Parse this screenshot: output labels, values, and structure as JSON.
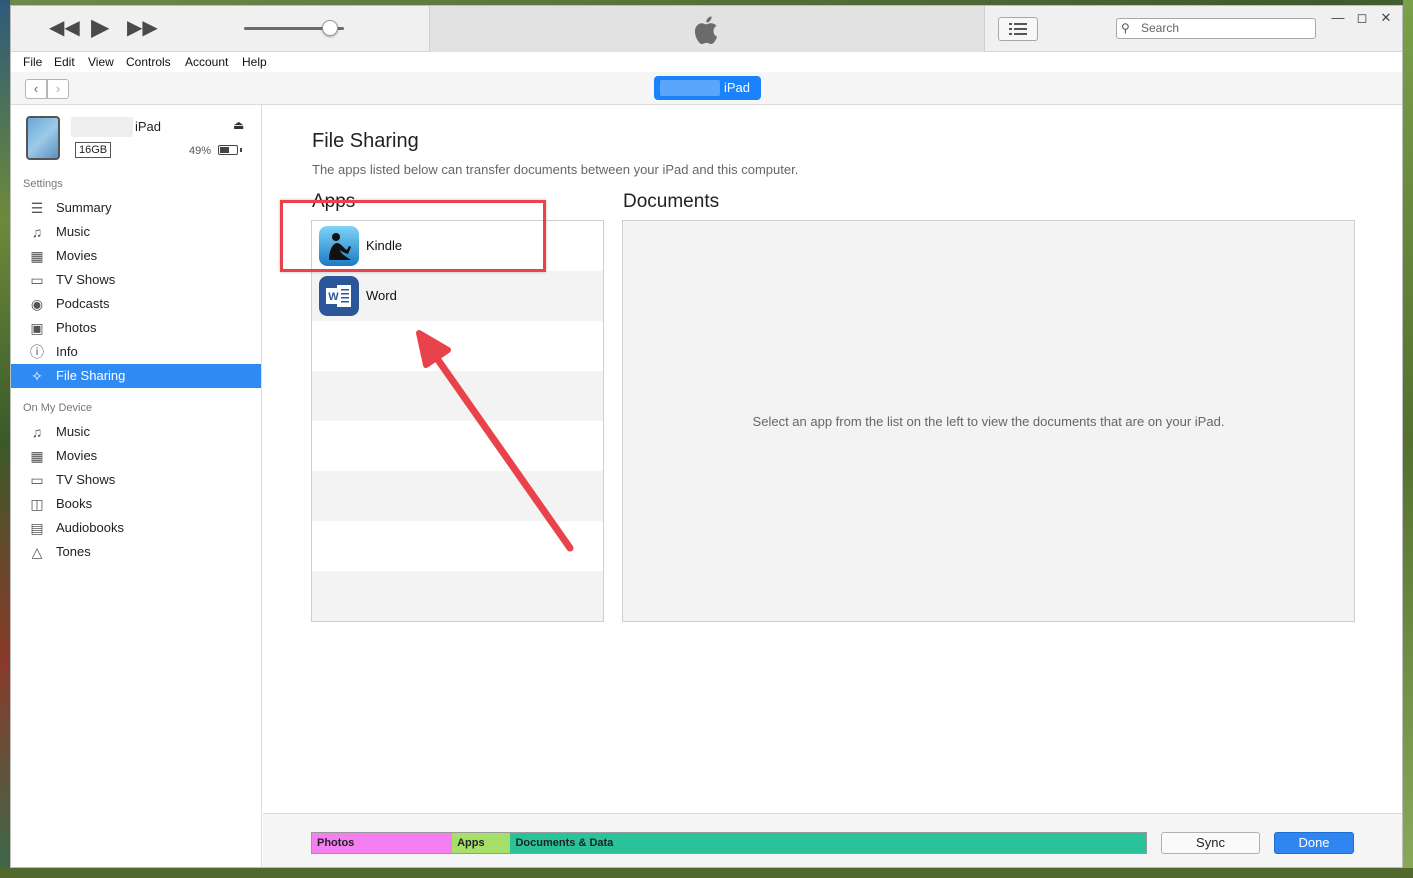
{
  "player": {
    "rewind_icon": "rewind-icon",
    "play_icon": "play-icon",
    "forward_icon": "fast-forward-icon",
    "volume": 0.86,
    "search_placeholder": "Search"
  },
  "menu": [
    "File",
    "Edit",
    "View",
    "Controls",
    "Account",
    "Help"
  ],
  "nav": {
    "back": "‹",
    "forward": "›",
    "device_pill": "iPad"
  },
  "device": {
    "name": "iPad",
    "capacity": "16GB",
    "battery": "49%",
    "battery_level": 0.49
  },
  "sidebar": {
    "settings_header": "Settings",
    "settings": [
      {
        "label": "Summary",
        "icon": "summary-icon"
      },
      {
        "label": "Music",
        "icon": "music-note-icon"
      },
      {
        "label": "Movies",
        "icon": "film-icon"
      },
      {
        "label": "TV Shows",
        "icon": "tv-icon"
      },
      {
        "label": "Podcasts",
        "icon": "podcast-icon"
      },
      {
        "label": "Photos",
        "icon": "camera-icon"
      },
      {
        "label": "Info",
        "icon": "info-icon"
      },
      {
        "label": "File Sharing",
        "icon": "app-store-icon",
        "active": true
      }
    ],
    "device_header": "On My Device",
    "on_device": [
      {
        "label": "Music",
        "icon": "music-note-icon"
      },
      {
        "label": "Movies",
        "icon": "film-icon"
      },
      {
        "label": "TV Shows",
        "icon": "tv-icon"
      },
      {
        "label": "Books",
        "icon": "book-icon"
      },
      {
        "label": "Audiobooks",
        "icon": "audiobook-icon"
      },
      {
        "label": "Tones",
        "icon": "bell-icon"
      }
    ]
  },
  "main": {
    "title": "File Sharing",
    "description": "The apps listed below can transfer documents between your iPad and this computer.",
    "apps_header": "Apps",
    "documents_header": "Documents",
    "apps": [
      {
        "name": "Kindle",
        "icon": "kindle-icon"
      },
      {
        "name": "Word",
        "icon": "word-icon"
      }
    ],
    "documents_hint": "Select an app from the list on the left to view the documents that are on your iPad."
  },
  "storage": [
    {
      "label": "Photos",
      "color": "#f57ef0",
      "fraction": 0.168
    },
    {
      "label": "Apps",
      "color": "#a6e06a",
      "fraction": 0.07
    },
    {
      "label": "Documents & Data",
      "color": "#29c29a",
      "fraction": 0.762
    }
  ],
  "footer": {
    "sync": "Sync",
    "done": "Done"
  }
}
